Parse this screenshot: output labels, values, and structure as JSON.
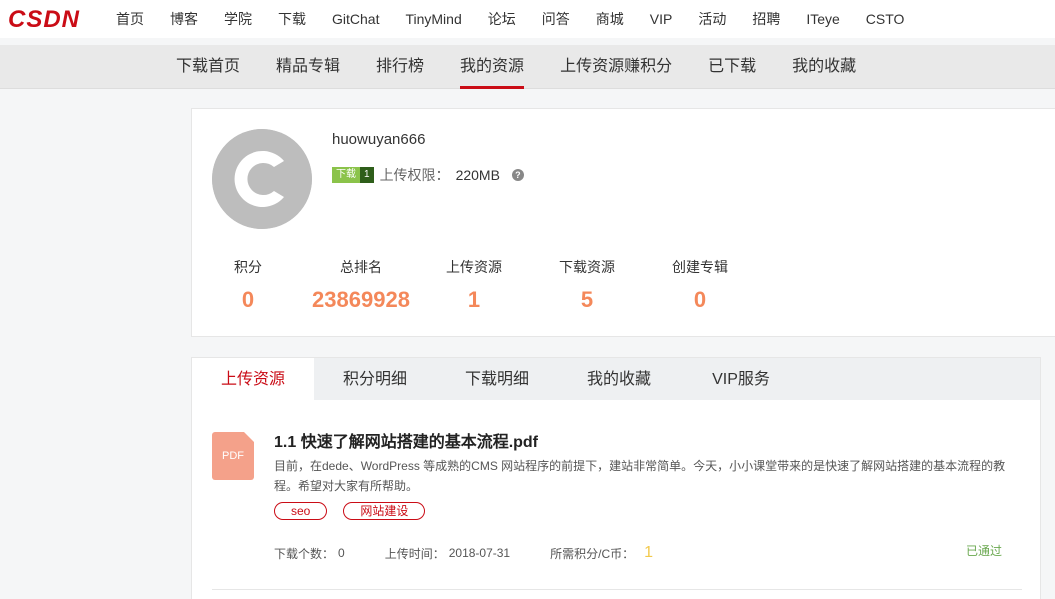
{
  "brand": {
    "logo_text": "CSDN",
    "accent": "#ca0c16"
  },
  "topnav": {
    "items": [
      "首页",
      "博客",
      "学院",
      "下载",
      "GitChat",
      "TinyMind",
      "论坛",
      "问答",
      "商城",
      "VIP",
      "活动",
      "招聘",
      "ITeye",
      "CSTO"
    ]
  },
  "subnav": {
    "items": [
      "下载首页",
      "精品专辑",
      "排行榜",
      "我的资源",
      "上传资源赚积分",
      "已下载",
      "我的收藏"
    ],
    "active_index": 3
  },
  "profile": {
    "username": "huowuyan666",
    "badge_label": "下载",
    "badge_level": "1",
    "quota_label": "上传权限：",
    "quota_value": "220MB",
    "help_icon": "question-circle-icon",
    "stats": [
      {
        "label": "积分",
        "value": "0"
      },
      {
        "label": "总排名",
        "value": "23869928"
      },
      {
        "label": "上传资源",
        "value": "1"
      },
      {
        "label": "下载资源",
        "value": "5"
      },
      {
        "label": "创建专辑",
        "value": "0"
      }
    ],
    "stat_color": "#f4885a"
  },
  "tabs": {
    "items": [
      "上传资源",
      "积分明细",
      "下载明细",
      "我的收藏",
      "VIP服务"
    ],
    "active_index": 0
  },
  "resource": {
    "icon_text": "PDF",
    "title": "1.1 快速了解网站搭建的基本流程.pdf",
    "description": "目前，在dede、WordPress 等成熟的CMS 网站程序的前提下，建站非常简单。今天，小小课堂带来的是快速了解网站搭建的基本流程的教程。希望对大家有所帮助。",
    "tags": [
      "seo",
      "网站建设"
    ],
    "download_count_label": "下载个数：",
    "download_count": "0",
    "upload_time_label": "上传时间：",
    "upload_time": "2018-07-31",
    "points_label": "所需积分/C币：",
    "points": "1",
    "status": "已通过",
    "status_color": "#6aa84f"
  }
}
